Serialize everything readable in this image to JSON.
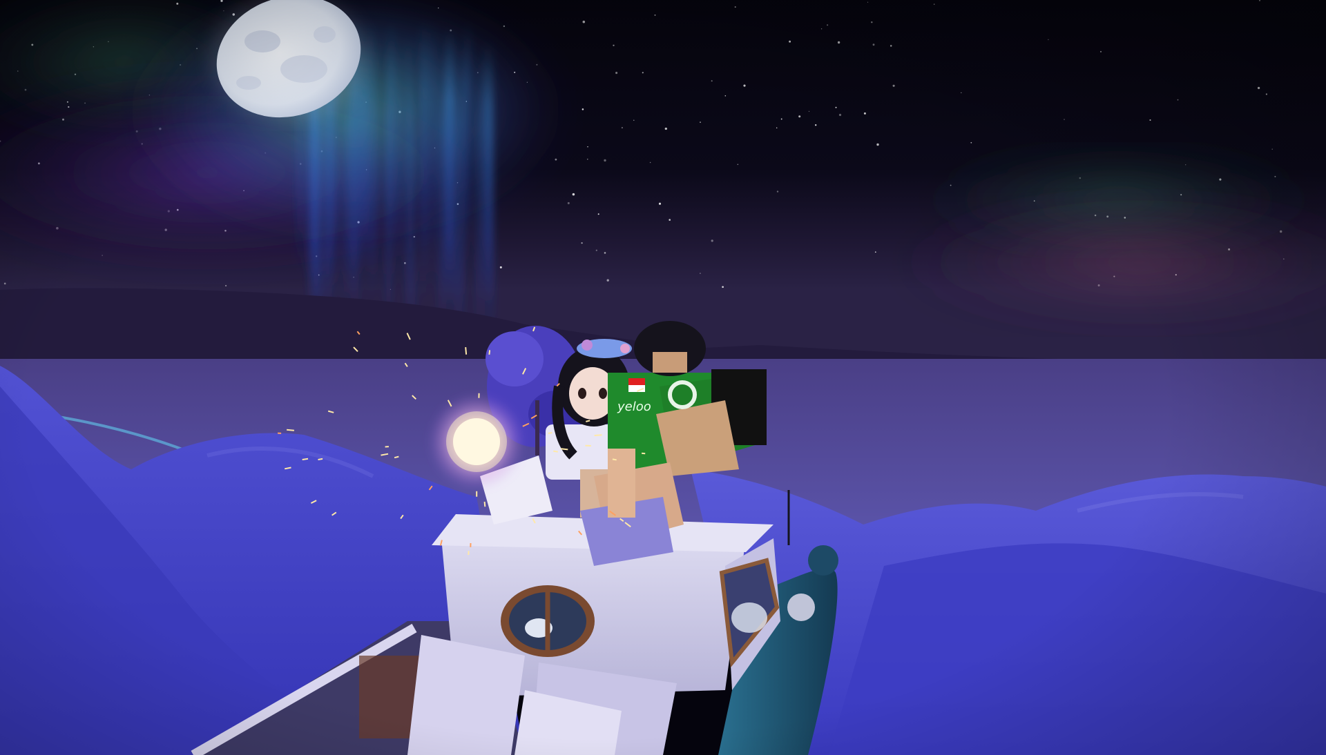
{
  "scene": {
    "kind": "roblox-style night scene",
    "elements": [
      "night-sky",
      "moon",
      "aurora",
      "distant-mountains",
      "frozen-sea",
      "snow-dunes",
      "boat-cabin",
      "sparkler",
      "avatar-girl",
      "avatar-boy",
      "blossom-tree"
    ]
  },
  "colors": {
    "sky_top": "#05040d",
    "sky_horizon": "#2a1f45",
    "aurora_green": "#49d6a6",
    "aurora_blue": "#2f6fd6",
    "aurora_purple": "#6b3fb0",
    "moon": "#e9eef7",
    "snow": "#4646c8",
    "snow_highlight": "#7a7ae6",
    "sea": "#5a4fa6",
    "cabin": "#d9d6ef",
    "boat_hull": "#1f5a78",
    "spark": "#fff1c4",
    "shirt_green": "#1f8a2c",
    "hair": "#15131c"
  },
  "avatar_boy": {
    "shirt_text": "yeloo",
    "flag": "red-white"
  }
}
